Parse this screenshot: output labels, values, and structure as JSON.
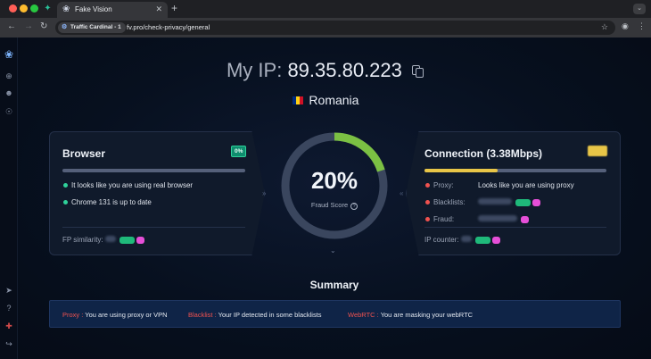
{
  "browser": {
    "tab_title": "Fake Vision",
    "profile_chip": "Traffic Cardinal - 1",
    "url": "fv.pro/check-privacy/general"
  },
  "ip": {
    "label": "My IP:",
    "value": "89.35.80.223",
    "country": "Romania"
  },
  "browser_card": {
    "title": "Browser",
    "badge": "0%",
    "checks": [
      "It looks like you are using real browser",
      "Chrome 131 is up to date"
    ],
    "fp_similarity_label": "FP similarity:"
  },
  "gauge": {
    "score": "20%",
    "score_value": 0.2,
    "label": "Fraud Score"
  },
  "connection_card": {
    "title": "Connection",
    "speed": "(3.38Mbps)",
    "bar_fill": 0.4,
    "proxy_label": "Proxy:",
    "proxy_value": "Looks like you are using proxy",
    "blacklists_label": "Blacklists:",
    "fraud_label": "Fraud:",
    "ip_counter_label": "IP counter:"
  },
  "summary": {
    "title": "Summary",
    "items": [
      {
        "key": "Proxy :",
        "text": "You are using proxy or VPN"
      },
      {
        "key": "Blacklist :",
        "text": "Your IP detected in some blacklists"
      },
      {
        "key": "WebRTC :",
        "text": "You are masking your webRTC"
      }
    ]
  },
  "colors": {
    "accent_green": "#7bc043",
    "warning_yellow": "#e8c547",
    "danger_red": "#f0524f",
    "ok_green": "#2fd19a"
  },
  "icons": [
    "fake-vision-logo-icon",
    "plus-circle-icon",
    "user-icon",
    "fingerprint-icon",
    "telegram-icon",
    "help-icon",
    "flag-uk-icon",
    "exit-icon",
    "copy-icon",
    "star-icon"
  ]
}
